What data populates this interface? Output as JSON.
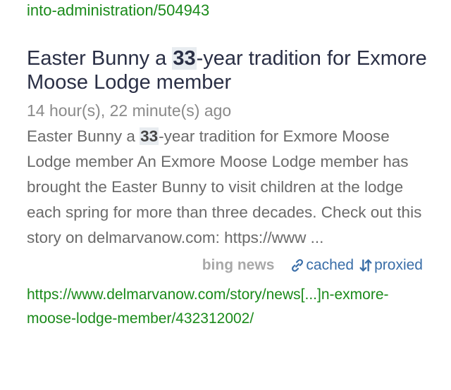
{
  "previous_result": {
    "url_tail": "into-administration/504943"
  },
  "result": {
    "title_pre": "Easter Bunny a ",
    "title_highlight": "33",
    "title_post": "-year tradition for Exmore Moose Lodge member",
    "time": "14 hour(s), 22 minute(s) ago",
    "snippet_pre": "Easter Bunny a ",
    "snippet_highlight": "33",
    "snippet_post": "-year tradition for Exmore Moose Lodge member An Exmore Moose Lodge member has brought the Easter Bunny to visit children at the lodge each spring for more than three decades. Check out this story on delmarvanow.com: https://www ...",
    "source": "bing news",
    "cached_label": "cached",
    "proxied_label": "proxied",
    "url": "https://www.delmarvanow.com/story/news[...]n-exmore-moose-lodge-member/432312002/"
  },
  "colors": {
    "url_green": "#1a8a1a",
    "title": "#2a2f45",
    "link_blue": "#3a6ea8",
    "muted": "#8a8a8a"
  },
  "icons": {
    "cached": "link-icon",
    "proxied": "sort-arrows-icon"
  }
}
